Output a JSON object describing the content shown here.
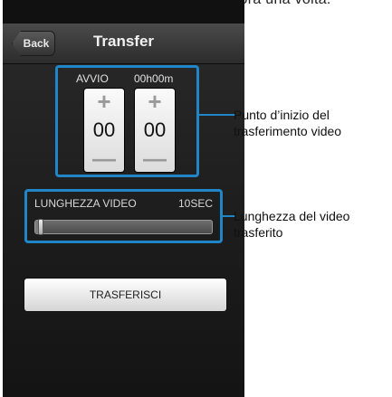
{
  "page_caption": "ccare “TRASFERISCI” ancora una volta.",
  "header": {
    "back_label": "Back",
    "title": "Transfer"
  },
  "start": {
    "label": "AVVIO",
    "time": "00h00m",
    "up_symbol": "+",
    "down_symbol": "—",
    "hours_value": "00",
    "minutes_value": "00"
  },
  "length": {
    "label": "LUNGHEZZA VIDEO",
    "value": "10SEC",
    "slider_level": 0.03
  },
  "transfer_button_label": "TRASFERISCI",
  "callouts": {
    "start_line1": "Punto d’inizio del",
    "start_line2": "trasferimento video",
    "length_line1": "Lunghezza del video",
    "length_line2": "trasferito"
  },
  "colors": {
    "accent": "#1f86c8"
  }
}
